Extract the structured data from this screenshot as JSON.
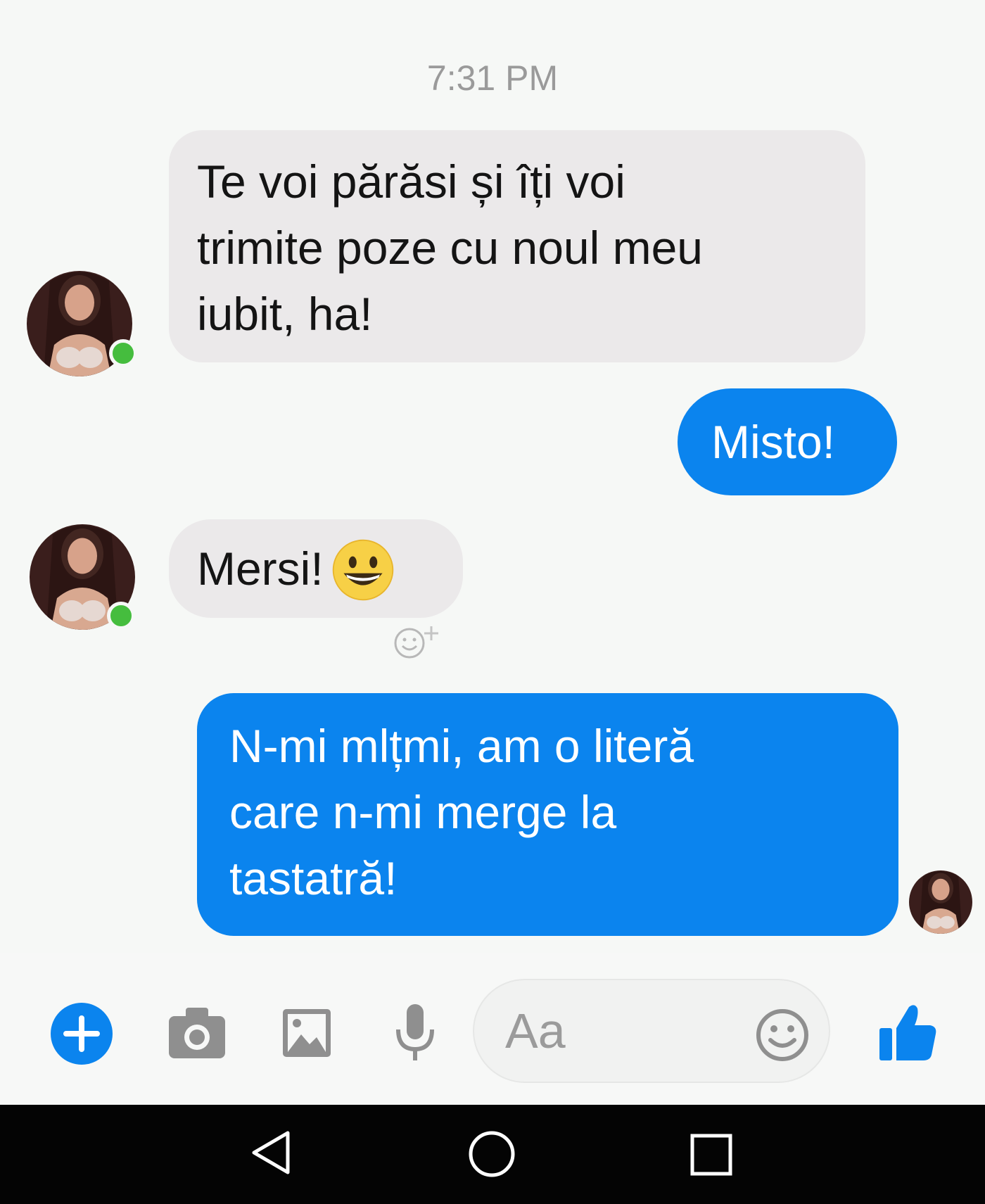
{
  "chat": {
    "timestamp": "7:31 PM",
    "messages": [
      {
        "direction": "incoming",
        "lines": [
          "Te voi părăsi și îți voi",
          "trimite poze cu noul meu",
          "iubit, ha!"
        ]
      },
      {
        "direction": "outgoing",
        "lines": [
          "Misto!"
        ]
      },
      {
        "direction": "incoming",
        "lines": [
          "Mersi!"
        ],
        "emoji": "grinning-face-emoji"
      },
      {
        "direction": "outgoing",
        "lines": [
          "N-mi mlțmi, am o literă",
          "care n-mi merge la",
          "tastatră!"
        ]
      }
    ]
  },
  "composer": {
    "placeholder": "Aa",
    "icons": [
      "plus-icon",
      "camera-icon",
      "image-icon",
      "microphone-icon",
      "emoji-icon",
      "thumbs-up-icon"
    ]
  },
  "navbar": {
    "icons": [
      "back-icon",
      "home-icon",
      "recents-icon"
    ]
  },
  "colors": {
    "accent": "#0b84ee",
    "incoming_bubble": "#ebe9ea",
    "online": "#45bd3e",
    "background": "#f6f8f6"
  }
}
